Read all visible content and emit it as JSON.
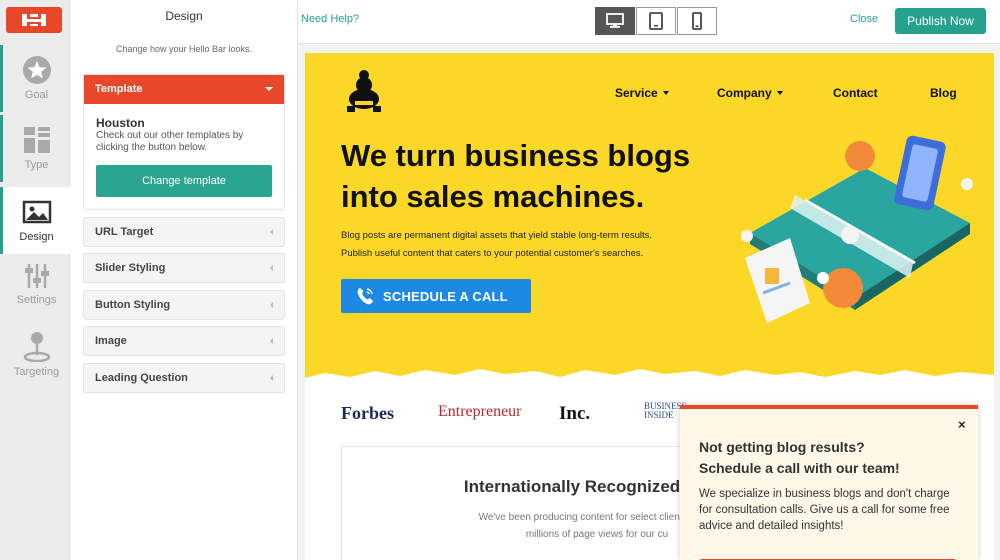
{
  "colors": {
    "accent": "#25a18e",
    "brand": "#e8472a",
    "hero_bg": "#fbd827",
    "cta": "#1e88e5"
  },
  "rail": {
    "logo_icon": "hellobar-logo-icon",
    "items": [
      {
        "label": "Goal",
        "icon": "star-icon"
      },
      {
        "label": "Type",
        "icon": "layout-icon"
      },
      {
        "label": "Design",
        "icon": "image-icon"
      },
      {
        "label": "Settings",
        "icon": "sliders-icon"
      },
      {
        "label": "Targeting",
        "icon": "pin-icon"
      }
    ]
  },
  "panel": {
    "title": "Design",
    "subtitle": "Change how your Hello Bar looks.",
    "template": {
      "header": "Template",
      "name": "Houston",
      "description": "Check out our other templates by clicking the button below.",
      "button": "Change template"
    },
    "sections": [
      "URL Target",
      "Slider Styling",
      "Button Styling",
      "Image",
      "Leading Question"
    ]
  },
  "topbar": {
    "need_help": "Need Help?",
    "devices": [
      "desktop-icon",
      "tablet-icon",
      "mobile-icon"
    ],
    "close": "Close",
    "publish": "Publish Now"
  },
  "preview": {
    "nav": [
      "Service",
      "Company",
      "Contact",
      "Blog"
    ],
    "headline": "We turn business blogs into sales machines.",
    "paragraph_1": "Blog posts are permanent digital assets that yield stable long-term results.",
    "paragraph_2": "Publish useful content that caters to your potential customer's searches.",
    "cta": "SCHEDULE A CALL",
    "press": {
      "forbes": "Forbes",
      "entrepreneur": "Entrepreneur",
      "inc": "Inc.",
      "business_1": "BUSINESS",
      "business_2": "INSIDE"
    },
    "card_title": "Internationally Recognized",
    "card_line_1": "We've been producing content for select clients for ov",
    "card_line_2": "millions of page views for our cu"
  },
  "popup": {
    "close": "×",
    "heading_1": "Not getting blog results?",
    "heading_2": "Schedule a call with our team!",
    "body": "We specialize in business blogs and don't charge for consultation calls. Give us a call for some free advice and detailed insights!"
  }
}
